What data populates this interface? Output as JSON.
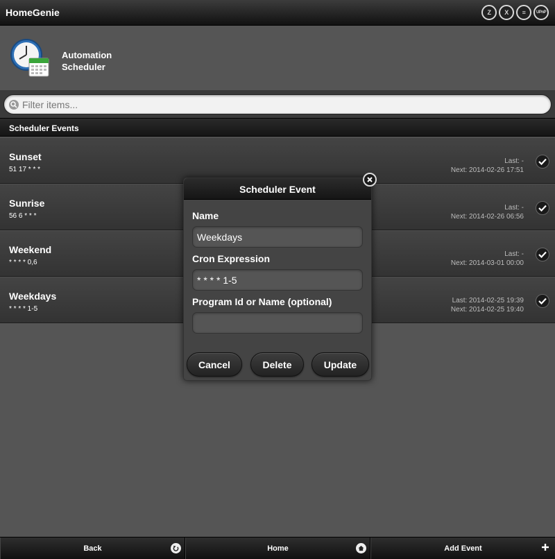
{
  "header": {
    "title": "HomeGenie",
    "icons": [
      {
        "name": "zwave-icon",
        "glyph": "Z"
      },
      {
        "name": "x10-icon",
        "glyph": "X"
      },
      {
        "name": "insteon-icon",
        "glyph": "≡"
      },
      {
        "name": "upnp-icon",
        "glyph": "UPnP"
      }
    ]
  },
  "module": {
    "title_line1": "Automation",
    "title_line2": "Scheduler",
    "icon": "clock-calendar-icon"
  },
  "filter": {
    "placeholder": "Filter items..."
  },
  "list": {
    "divider": "Scheduler Events",
    "events": [
      {
        "name": "Sunset",
        "cron": "51 17 * * *",
        "last": "Last: -",
        "next": "Next: 2014-02-26 17:51"
      },
      {
        "name": "Sunrise",
        "cron": "56 6 * * *",
        "last": "Last: -",
        "next": "Next: 2014-02-26 06:56"
      },
      {
        "name": "Weekend",
        "cron": "* * * * 0,6",
        "last": "Last: -",
        "next": "Next: 2014-03-01 00:00"
      },
      {
        "name": "Weekdays",
        "cron": "* * * * 1-5",
        "last": "Last: 2014-02-25 19:39",
        "next": "Next: 2014-02-25 19:40"
      }
    ]
  },
  "dialog": {
    "title": "Scheduler Event",
    "name_label": "Name",
    "name_value": "Weekdays",
    "cron_label": "Cron Expression",
    "cron_value": "* * * * 1-5",
    "program_label": "Program Id or Name (optional)",
    "program_value": "",
    "cancel_label": "Cancel",
    "delete_label": "Delete",
    "update_label": "Update"
  },
  "footer": {
    "back_label": "Back",
    "home_label": "Home",
    "add_label": "Add Event"
  },
  "colors": {
    "background": "#555555",
    "bar": "#111111",
    "text": "#ffffff",
    "subtext": "#bdbdbd"
  }
}
